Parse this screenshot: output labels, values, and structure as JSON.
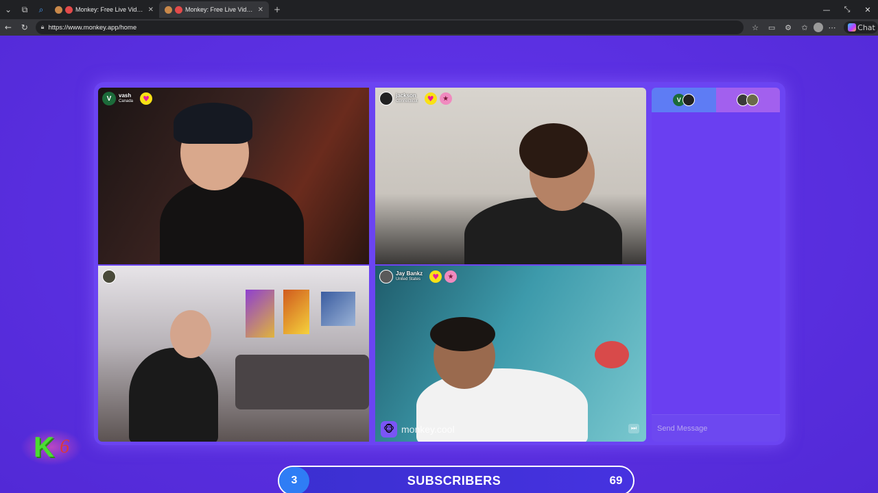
{
  "browser": {
    "tabs": [
      {
        "title": "Monkey: Free Live Video Chat"
      },
      {
        "title": "Monkey: Free Live Video Chat"
      }
    ],
    "url": "https://www.monkey.app/home",
    "copilot_label": "Chat"
  },
  "tiles": [
    {
      "avatar_letter": "V",
      "avatar_color": "#1c6b3a",
      "name": "vash",
      "location": "Canada"
    },
    {
      "avatar_letter": "",
      "avatar_color": "#222222",
      "name": "jackson",
      "location": "Connecticut"
    },
    {
      "avatar_letter": "",
      "avatar_color": "#4a4a3a",
      "name": "",
      "location": ""
    },
    {
      "avatar_letter": "",
      "avatar_color": "#5a5a5a",
      "name": "Jay Bankz",
      "location": "United States"
    }
  ],
  "watermark": {
    "text": "monkey.cool",
    "icon": "monkey-icon"
  },
  "chat": {
    "tab_a_letter": "V",
    "input_placeholder": "Send Message"
  },
  "overlay": {
    "k_letter": "K",
    "k_number": "6",
    "subscribers_current": "3",
    "subscribers_label": "SUBSCRIBERS",
    "subscribers_goal": "69"
  },
  "colors": {
    "page_bg": "#5a2fe0",
    "heart_bg": "#f9e115",
    "accent_green": "#4bdc33"
  }
}
